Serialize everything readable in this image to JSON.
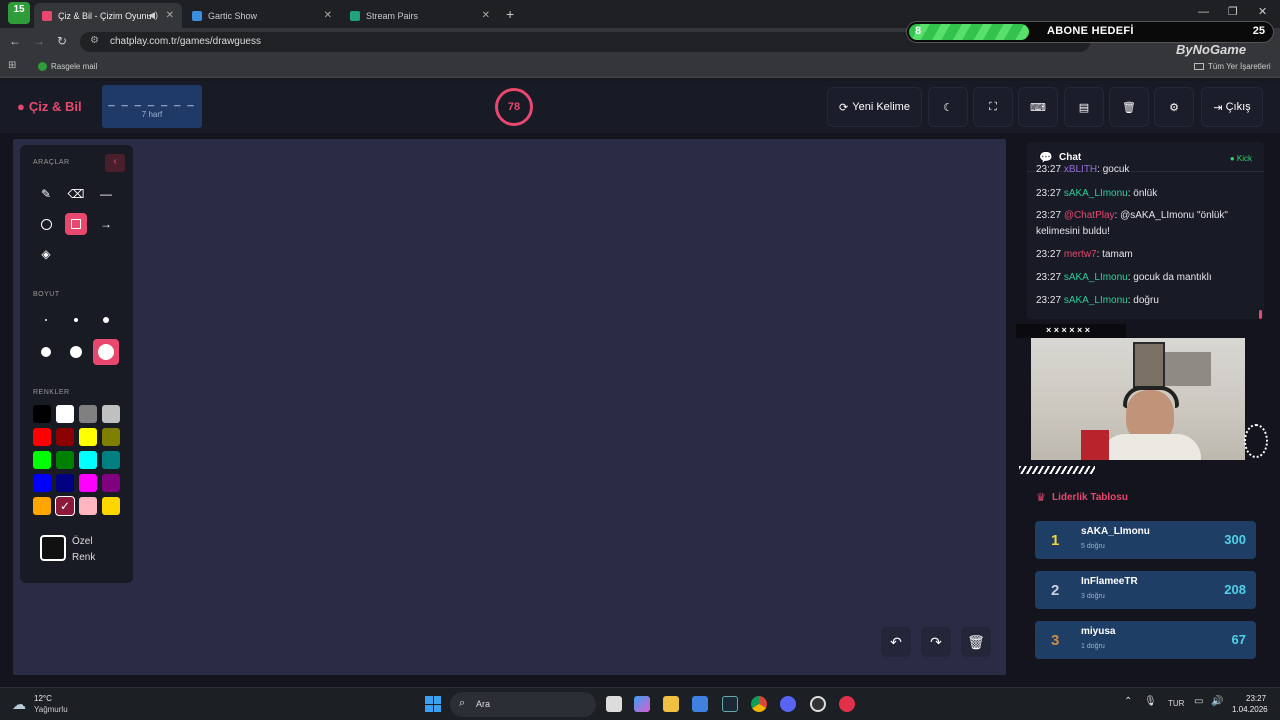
{
  "browser": {
    "tabs": [
      {
        "label": "Çiz & Bil - Çizim Oyunu",
        "active": true
      },
      {
        "label": "Gartic Show",
        "active": false
      },
      {
        "label": "Stream Pairs",
        "active": false
      }
    ],
    "tab_badge": "15",
    "url": "chatplay.com.tr/games/drawguess",
    "bookmark_left": "Rasgele mail",
    "bookmark_right": "Tüm Yer İşaretleri"
  },
  "overlay": {
    "abone_current": "8",
    "abone_label": "ABONE HEDEFİ",
    "abone_target": "25",
    "brand": "ByNoGame"
  },
  "app": {
    "logo": "Çiz & Bil",
    "word_dashes": "_ _ _ _ _ _ _",
    "word_length": "7 harf",
    "timer": "78",
    "new_word_label": "Yeni Kelime",
    "exit_label": "Çıkış"
  },
  "tools": {
    "tools_title": "ARAÇLAR",
    "size_title": "BOYUT",
    "colors_title": "RENKLER",
    "custom_color_label": "Özel Renk",
    "colors": [
      "#000000",
      "#ffffff",
      "#808080",
      "#c0c0c0",
      "#ff0000",
      "#8b0000",
      "#ffff00",
      "#808000",
      "#00ff00",
      "#008000",
      "#00ffff",
      "#008080",
      "#0000ff",
      "#000080",
      "#ff00ff",
      "#800080",
      "#ffa500",
      "#8b1a3a",
      "#ffb6c1",
      "#ffd700"
    ]
  },
  "chat": {
    "title": "Chat",
    "platform": "Kick",
    "messages": [
      {
        "time": "23:27",
        "user": "xBLITH",
        "text": ": gocuk",
        "color": "#9a6bd8"
      },
      {
        "time": "23:27",
        "user": "sAKA_LImonu",
        "text": ": önlük",
        "color": "#2ecc9a"
      },
      {
        "time": "23:27",
        "user": "@ChatPlay",
        "text": ": @sAKA_LImonu \"önlük\" kelimesini buldu!",
        "color": "#e8476e"
      },
      {
        "time": "23:27",
        "user": "mertw7",
        "text": ": tamam",
        "color": "#e8476e"
      },
      {
        "time": "23:27",
        "user": "sAKA_LImonu",
        "text": ": gocuk da mantıklı",
        "color": "#2ecc9a"
      },
      {
        "time": "23:27",
        "user": "sAKA_LImonu",
        "text": ": doğru",
        "color": "#2ecc9a"
      }
    ]
  },
  "cam": {
    "strip": "× × × × × ×"
  },
  "leaderboard": {
    "title": "Liderlik Tablosu",
    "rows": [
      {
        "rank": "1",
        "name": "sAKA_LImonu",
        "sub": "5 doğru",
        "score": "300",
        "rank_color": "#f5d33b"
      },
      {
        "rank": "2",
        "name": "InFlameeTR",
        "sub": "3 doğru",
        "score": "208",
        "rank_color": "#c9d1dc"
      },
      {
        "rank": "3",
        "name": "miyusa",
        "sub": "1 doğru",
        "score": "67",
        "rank_color": "#d08a48"
      }
    ]
  },
  "taskbar": {
    "weather_temp": "12°C",
    "weather_desc": "Yağmurlu",
    "search": "Ara",
    "lang": "TUR",
    "time": "23:27",
    "date": "1.04.2026"
  }
}
